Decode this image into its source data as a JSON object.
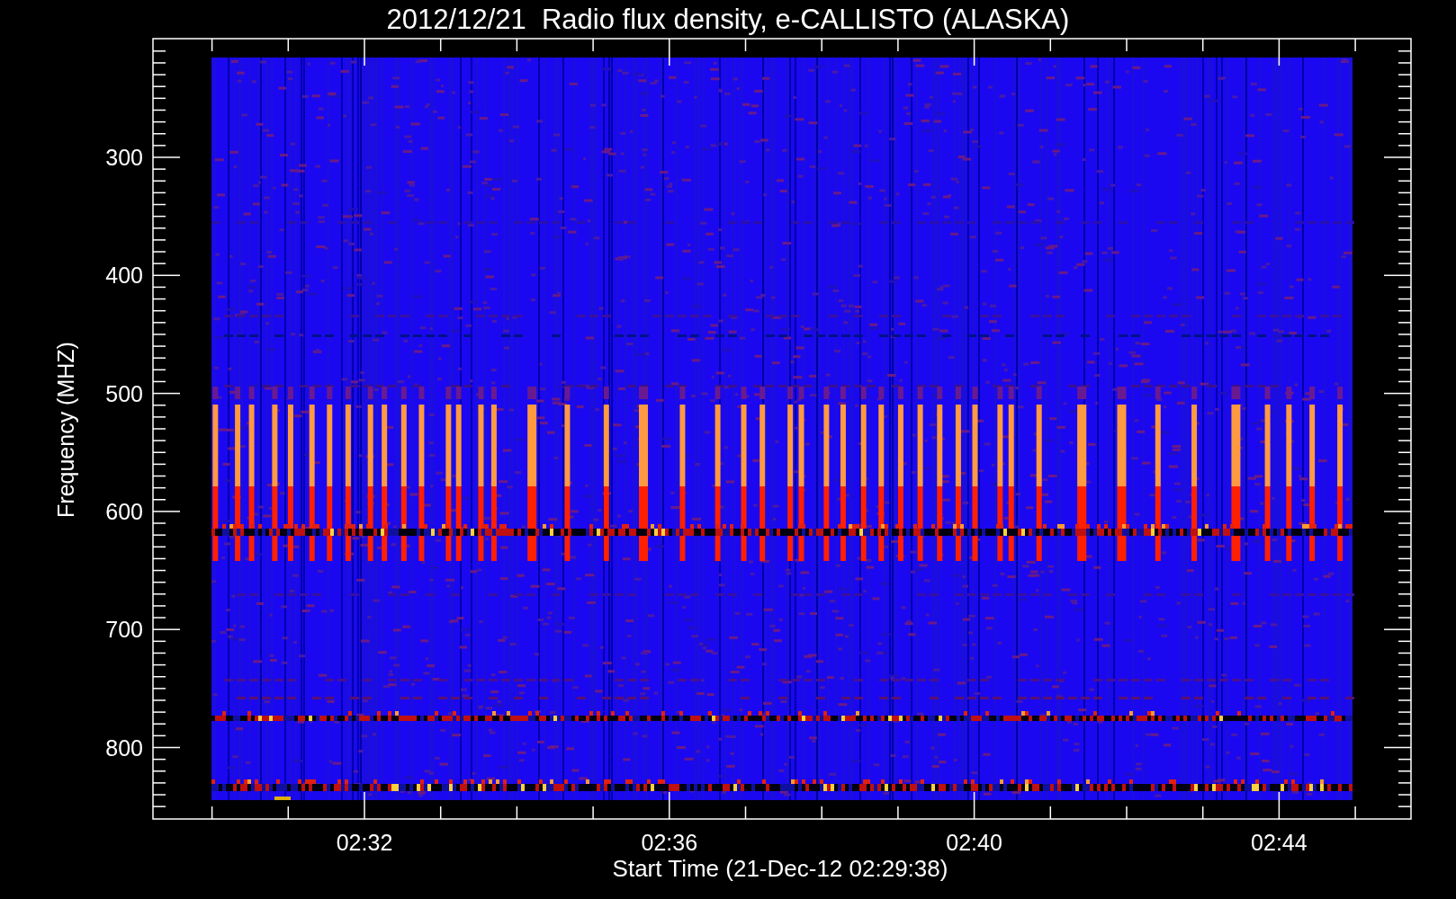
{
  "title": "2012/12/21  Radio flux density, e-CALLISTO (ALASKA)",
  "ylabel": "Frequency (MHZ)",
  "xlabel": "Start Time (21-Dec-12 02:29:38)",
  "yticks": [
    "300",
    "400",
    "500",
    "600",
    "700",
    "800"
  ],
  "xticks": [
    "02:32",
    "02:36",
    "02:40",
    "02:44"
  ]
}
